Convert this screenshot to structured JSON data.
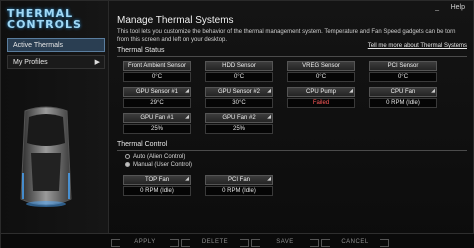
{
  "window": {
    "help_label": "Help",
    "minimize_label": "_"
  },
  "sidebar": {
    "logo_line1": "THERMAL",
    "logo_line2": "CONTROLS",
    "items": [
      {
        "label": "Active Thermals"
      },
      {
        "label": "My Profiles"
      }
    ]
  },
  "main": {
    "title": "Manage Thermal Systems",
    "description": "This tool lets you customize the behavior of the thermal management system. Temperature and Fan Speed gadgets can be torn from this screen and left on your desktop.",
    "tell_me_link": "Tell me more about Thermal Systems",
    "status_heading": "Thermal Status",
    "control_heading": "Thermal Control",
    "sensors": [
      {
        "name": "Front Ambient Sensor",
        "value": "0°C",
        "failed": false
      },
      {
        "name": "HDD Sensor",
        "value": "0°C",
        "failed": false
      },
      {
        "name": "VREG Sensor",
        "value": "0°C",
        "failed": false
      },
      {
        "name": "PCI Sensor",
        "value": "0°C",
        "failed": false
      },
      {
        "name": "GPU Sensor #1",
        "value": "29°C",
        "failed": false
      },
      {
        "name": "GPU Sensor #2",
        "value": "30°C",
        "failed": false
      },
      {
        "name": "CPU Pump",
        "value": "Failed",
        "failed": true
      },
      {
        "name": "CPU Fan",
        "value": "0 RPM (Idle)",
        "failed": false
      },
      {
        "name": "GPU Fan #1",
        "value": "25%",
        "failed": false
      },
      {
        "name": "GPU Fan #2",
        "value": "25%",
        "failed": false
      }
    ],
    "control_options": [
      {
        "label": "Auto (Alien Control)",
        "selected": false
      },
      {
        "label": "Manual (User Control)",
        "selected": true
      }
    ],
    "fans": [
      {
        "name": "TOP Fan",
        "value": "0 RPM (Idle)"
      },
      {
        "name": "PCI Fan",
        "value": "0 RPM (Idle)"
      }
    ]
  },
  "bottom_bar": {
    "apply": "APPLY",
    "delete": "DELETE",
    "save": "SAVE",
    "cancel": "CANCEL"
  },
  "colors": {
    "accent": "#9fd8f5",
    "failed": "#ff5a5a",
    "nav_active": "#2a3e52"
  }
}
